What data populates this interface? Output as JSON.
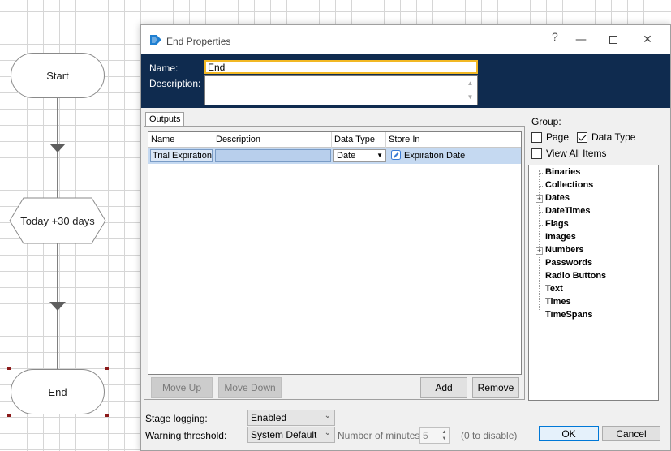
{
  "canvas": {
    "start_label": "Start",
    "calc_label": "Today +30 days",
    "end_label": "End"
  },
  "dialog": {
    "title": "End Properties",
    "help_glyph": "?",
    "name_label": "Name:",
    "name_value": "End",
    "description_label": "Description:",
    "description_value": "",
    "outputs_tab": "Outputs",
    "columns": [
      "Name",
      "Description",
      "Data Type",
      "Store In"
    ],
    "rows": [
      {
        "name": "Trial Expiration",
        "description": "",
        "data_type": "Date",
        "store_in": "Expiration Date"
      }
    ],
    "buttons": {
      "move_up": "Move Up",
      "move_down": "Move Down",
      "add": "Add",
      "remove": "Remove",
      "ok": "OK",
      "cancel": "Cancel"
    },
    "group": {
      "label": "Group:",
      "page": {
        "label": "Page",
        "checked": false
      },
      "data_type": {
        "label": "Data Type",
        "checked": true
      },
      "view_all": {
        "label": "View All Items",
        "checked": false
      }
    },
    "tree_items": [
      {
        "label": "Binaries",
        "expandable": false
      },
      {
        "label": "Collections",
        "expandable": false
      },
      {
        "label": "Dates",
        "expandable": true
      },
      {
        "label": "DateTimes",
        "expandable": false
      },
      {
        "label": "Flags",
        "expandable": false
      },
      {
        "label": "Images",
        "expandable": false
      },
      {
        "label": "Numbers",
        "expandable": true
      },
      {
        "label": "Passwords",
        "expandable": false
      },
      {
        "label": "Radio Buttons",
        "expandable": false
      },
      {
        "label": "Text",
        "expandable": false
      },
      {
        "label": "Times",
        "expandable": false
      },
      {
        "label": "TimeSpans",
        "expandable": false
      }
    ],
    "footer": {
      "stage_logging_label": "Stage logging:",
      "stage_logging_value": "Enabled",
      "warning_label": "Warning threshold:",
      "warning_value": "System Default",
      "minutes_label": "Number of minutes",
      "minutes_value": "5",
      "disable_hint": "(0 to disable)"
    }
  },
  "icons": {
    "app": "blueprism-logo-icon",
    "minimize": "minimize-icon",
    "maximize": "maximize-icon",
    "close": "close-icon",
    "store": "data-item-icon"
  },
  "colors": {
    "header_bg": "#0f2b4f",
    "name_focus": "#f2b824",
    "row_selected": "#c5d9f1",
    "handle": "#8b1a1a"
  }
}
